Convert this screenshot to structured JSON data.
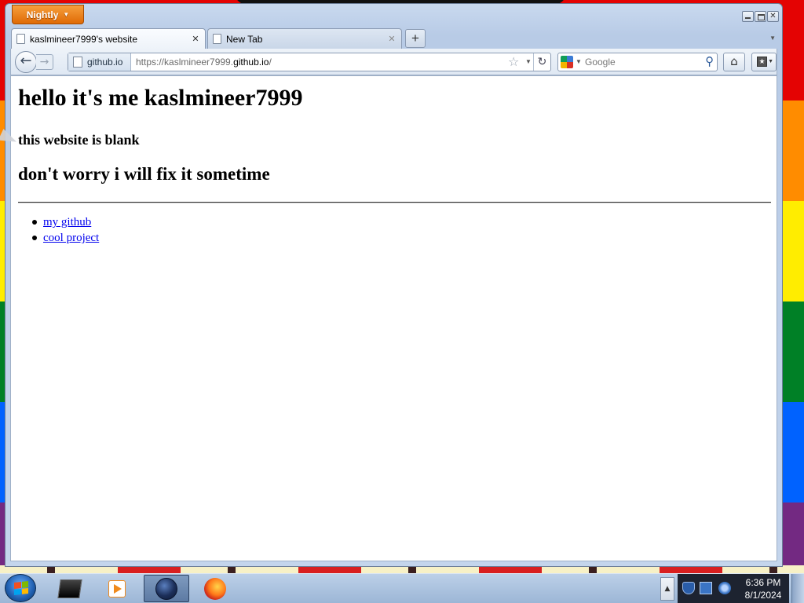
{
  "browser": {
    "app_button_label": "Nightly",
    "tabs": [
      {
        "title": "kaslmineer7999's website",
        "active": true
      },
      {
        "title": "New Tab",
        "active": false
      }
    ],
    "new_tab_label": "+",
    "address": {
      "identity_label": "github.io",
      "url_prefix": "https://kaslmineer7999.",
      "url_host": "github.io",
      "url_suffix": "/"
    },
    "search_placeholder": "Google"
  },
  "page": {
    "heading1": "hello it's me kaslmineer7999",
    "heading3": "this website is blank",
    "heading2": "don't worry i will fix it sometime",
    "links": [
      {
        "label": "my github"
      },
      {
        "label": "cool project"
      }
    ]
  },
  "taskbar": {
    "apps": [
      "terminal-icon",
      "media-player-icon",
      "nightly-icon",
      "firefox-icon"
    ],
    "active_app": "nightly-icon",
    "clock_time": "6:36 PM",
    "clock_date": "8/1/2024"
  },
  "colors": {
    "link": "#0000ee",
    "app_button": "#e06a05",
    "wallpaper": [
      "#e40303",
      "#ff8c00",
      "#ffed00",
      "#008026",
      "#0062ff",
      "#732982"
    ]
  }
}
